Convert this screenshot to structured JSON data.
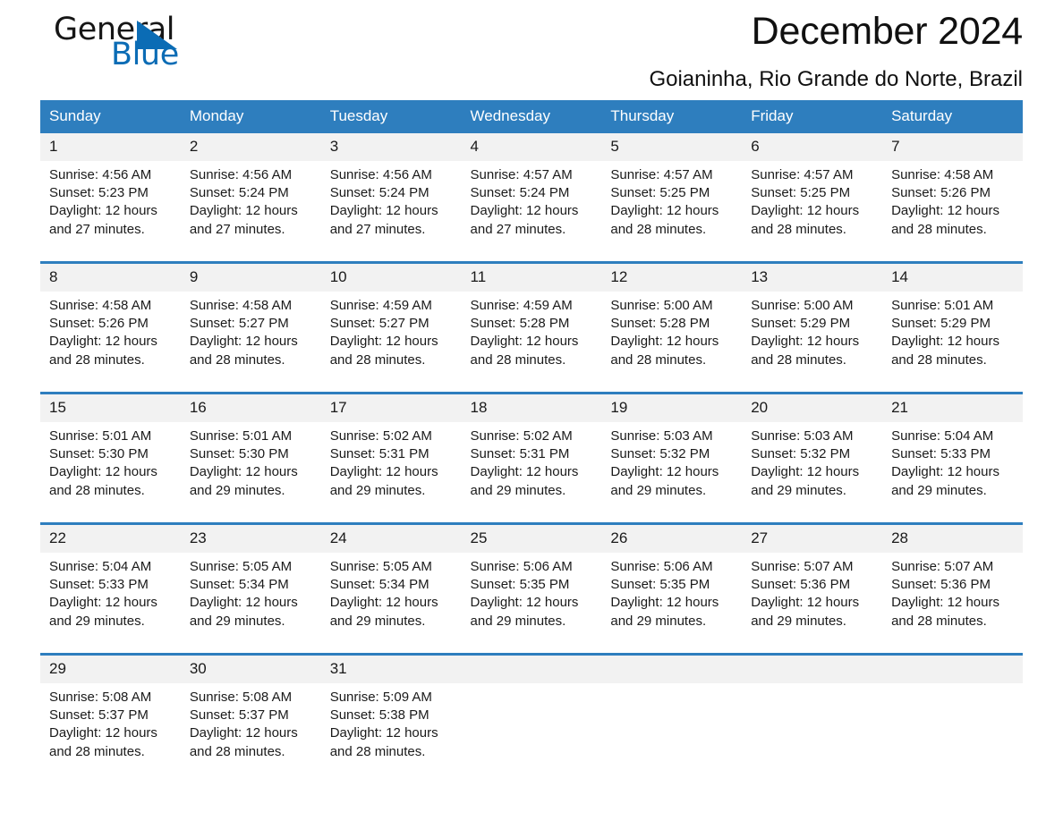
{
  "brand": {
    "name_part1": "General",
    "name_part2": "Blue",
    "accent_color": "#0b6cb5",
    "triangle_icon": "triangle-icon"
  },
  "header": {
    "title": "December 2024",
    "subtitle": "Goianinha, Rio Grande do Norte, Brazil"
  },
  "theme": {
    "header_blue": "#2e7ebe",
    "daynum_strip": "#f2f2f2",
    "text": "#1a1a1a"
  },
  "weekdays": [
    "Sunday",
    "Monday",
    "Tuesday",
    "Wednesday",
    "Thursday",
    "Friday",
    "Saturday"
  ],
  "weeks": [
    {
      "days": [
        {
          "num": "1",
          "sunrise": "Sunrise: 4:56 AM",
          "sunset": "Sunset: 5:23 PM",
          "daylight1": "Daylight: 12 hours",
          "daylight2": "and 27 minutes."
        },
        {
          "num": "2",
          "sunrise": "Sunrise: 4:56 AM",
          "sunset": "Sunset: 5:24 PM",
          "daylight1": "Daylight: 12 hours",
          "daylight2": "and 27 minutes."
        },
        {
          "num": "3",
          "sunrise": "Sunrise: 4:56 AM",
          "sunset": "Sunset: 5:24 PM",
          "daylight1": "Daylight: 12 hours",
          "daylight2": "and 27 minutes."
        },
        {
          "num": "4",
          "sunrise": "Sunrise: 4:57 AM",
          "sunset": "Sunset: 5:24 PM",
          "daylight1": "Daylight: 12 hours",
          "daylight2": "and 27 minutes."
        },
        {
          "num": "5",
          "sunrise": "Sunrise: 4:57 AM",
          "sunset": "Sunset: 5:25 PM",
          "daylight1": "Daylight: 12 hours",
          "daylight2": "and 28 minutes."
        },
        {
          "num": "6",
          "sunrise": "Sunrise: 4:57 AM",
          "sunset": "Sunset: 5:25 PM",
          "daylight1": "Daylight: 12 hours",
          "daylight2": "and 28 minutes."
        },
        {
          "num": "7",
          "sunrise": "Sunrise: 4:58 AM",
          "sunset": "Sunset: 5:26 PM",
          "daylight1": "Daylight: 12 hours",
          "daylight2": "and 28 minutes."
        }
      ]
    },
    {
      "days": [
        {
          "num": "8",
          "sunrise": "Sunrise: 4:58 AM",
          "sunset": "Sunset: 5:26 PM",
          "daylight1": "Daylight: 12 hours",
          "daylight2": "and 28 minutes."
        },
        {
          "num": "9",
          "sunrise": "Sunrise: 4:58 AM",
          "sunset": "Sunset: 5:27 PM",
          "daylight1": "Daylight: 12 hours",
          "daylight2": "and 28 minutes."
        },
        {
          "num": "10",
          "sunrise": "Sunrise: 4:59 AM",
          "sunset": "Sunset: 5:27 PM",
          "daylight1": "Daylight: 12 hours",
          "daylight2": "and 28 minutes."
        },
        {
          "num": "11",
          "sunrise": "Sunrise: 4:59 AM",
          "sunset": "Sunset: 5:28 PM",
          "daylight1": "Daylight: 12 hours",
          "daylight2": "and 28 minutes."
        },
        {
          "num": "12",
          "sunrise": "Sunrise: 5:00 AM",
          "sunset": "Sunset: 5:28 PM",
          "daylight1": "Daylight: 12 hours",
          "daylight2": "and 28 minutes."
        },
        {
          "num": "13",
          "sunrise": "Sunrise: 5:00 AM",
          "sunset": "Sunset: 5:29 PM",
          "daylight1": "Daylight: 12 hours",
          "daylight2": "and 28 minutes."
        },
        {
          "num": "14",
          "sunrise": "Sunrise: 5:01 AM",
          "sunset": "Sunset: 5:29 PM",
          "daylight1": "Daylight: 12 hours",
          "daylight2": "and 28 minutes."
        }
      ]
    },
    {
      "days": [
        {
          "num": "15",
          "sunrise": "Sunrise: 5:01 AM",
          "sunset": "Sunset: 5:30 PM",
          "daylight1": "Daylight: 12 hours",
          "daylight2": "and 28 minutes."
        },
        {
          "num": "16",
          "sunrise": "Sunrise: 5:01 AM",
          "sunset": "Sunset: 5:30 PM",
          "daylight1": "Daylight: 12 hours",
          "daylight2": "and 29 minutes."
        },
        {
          "num": "17",
          "sunrise": "Sunrise: 5:02 AM",
          "sunset": "Sunset: 5:31 PM",
          "daylight1": "Daylight: 12 hours",
          "daylight2": "and 29 minutes."
        },
        {
          "num": "18",
          "sunrise": "Sunrise: 5:02 AM",
          "sunset": "Sunset: 5:31 PM",
          "daylight1": "Daylight: 12 hours",
          "daylight2": "and 29 minutes."
        },
        {
          "num": "19",
          "sunrise": "Sunrise: 5:03 AM",
          "sunset": "Sunset: 5:32 PM",
          "daylight1": "Daylight: 12 hours",
          "daylight2": "and 29 minutes."
        },
        {
          "num": "20",
          "sunrise": "Sunrise: 5:03 AM",
          "sunset": "Sunset: 5:32 PM",
          "daylight1": "Daylight: 12 hours",
          "daylight2": "and 29 minutes."
        },
        {
          "num": "21",
          "sunrise": "Sunrise: 5:04 AM",
          "sunset": "Sunset: 5:33 PM",
          "daylight1": "Daylight: 12 hours",
          "daylight2": "and 29 minutes."
        }
      ]
    },
    {
      "days": [
        {
          "num": "22",
          "sunrise": "Sunrise: 5:04 AM",
          "sunset": "Sunset: 5:33 PM",
          "daylight1": "Daylight: 12 hours",
          "daylight2": "and 29 minutes."
        },
        {
          "num": "23",
          "sunrise": "Sunrise: 5:05 AM",
          "sunset": "Sunset: 5:34 PM",
          "daylight1": "Daylight: 12 hours",
          "daylight2": "and 29 minutes."
        },
        {
          "num": "24",
          "sunrise": "Sunrise: 5:05 AM",
          "sunset": "Sunset: 5:34 PM",
          "daylight1": "Daylight: 12 hours",
          "daylight2": "and 29 minutes."
        },
        {
          "num": "25",
          "sunrise": "Sunrise: 5:06 AM",
          "sunset": "Sunset: 5:35 PM",
          "daylight1": "Daylight: 12 hours",
          "daylight2": "and 29 minutes."
        },
        {
          "num": "26",
          "sunrise": "Sunrise: 5:06 AM",
          "sunset": "Sunset: 5:35 PM",
          "daylight1": "Daylight: 12 hours",
          "daylight2": "and 29 minutes."
        },
        {
          "num": "27",
          "sunrise": "Sunrise: 5:07 AM",
          "sunset": "Sunset: 5:36 PM",
          "daylight1": "Daylight: 12 hours",
          "daylight2": "and 29 minutes."
        },
        {
          "num": "28",
          "sunrise": "Sunrise: 5:07 AM",
          "sunset": "Sunset: 5:36 PM",
          "daylight1": "Daylight: 12 hours",
          "daylight2": "and 28 minutes."
        }
      ]
    },
    {
      "days": [
        {
          "num": "29",
          "sunrise": "Sunrise: 5:08 AM",
          "sunset": "Sunset: 5:37 PM",
          "daylight1": "Daylight: 12 hours",
          "daylight2": "and 28 minutes."
        },
        {
          "num": "30",
          "sunrise": "Sunrise: 5:08 AM",
          "sunset": "Sunset: 5:37 PM",
          "daylight1": "Daylight: 12 hours",
          "daylight2": "and 28 minutes."
        },
        {
          "num": "31",
          "sunrise": "Sunrise: 5:09 AM",
          "sunset": "Sunset: 5:38 PM",
          "daylight1": "Daylight: 12 hours",
          "daylight2": "and 28 minutes."
        },
        {
          "num": "",
          "sunrise": "",
          "sunset": "",
          "daylight1": "",
          "daylight2": ""
        },
        {
          "num": "",
          "sunrise": "",
          "sunset": "",
          "daylight1": "",
          "daylight2": ""
        },
        {
          "num": "",
          "sunrise": "",
          "sunset": "",
          "daylight1": "",
          "daylight2": ""
        },
        {
          "num": "",
          "sunrise": "",
          "sunset": "",
          "daylight1": "",
          "daylight2": ""
        }
      ]
    }
  ]
}
